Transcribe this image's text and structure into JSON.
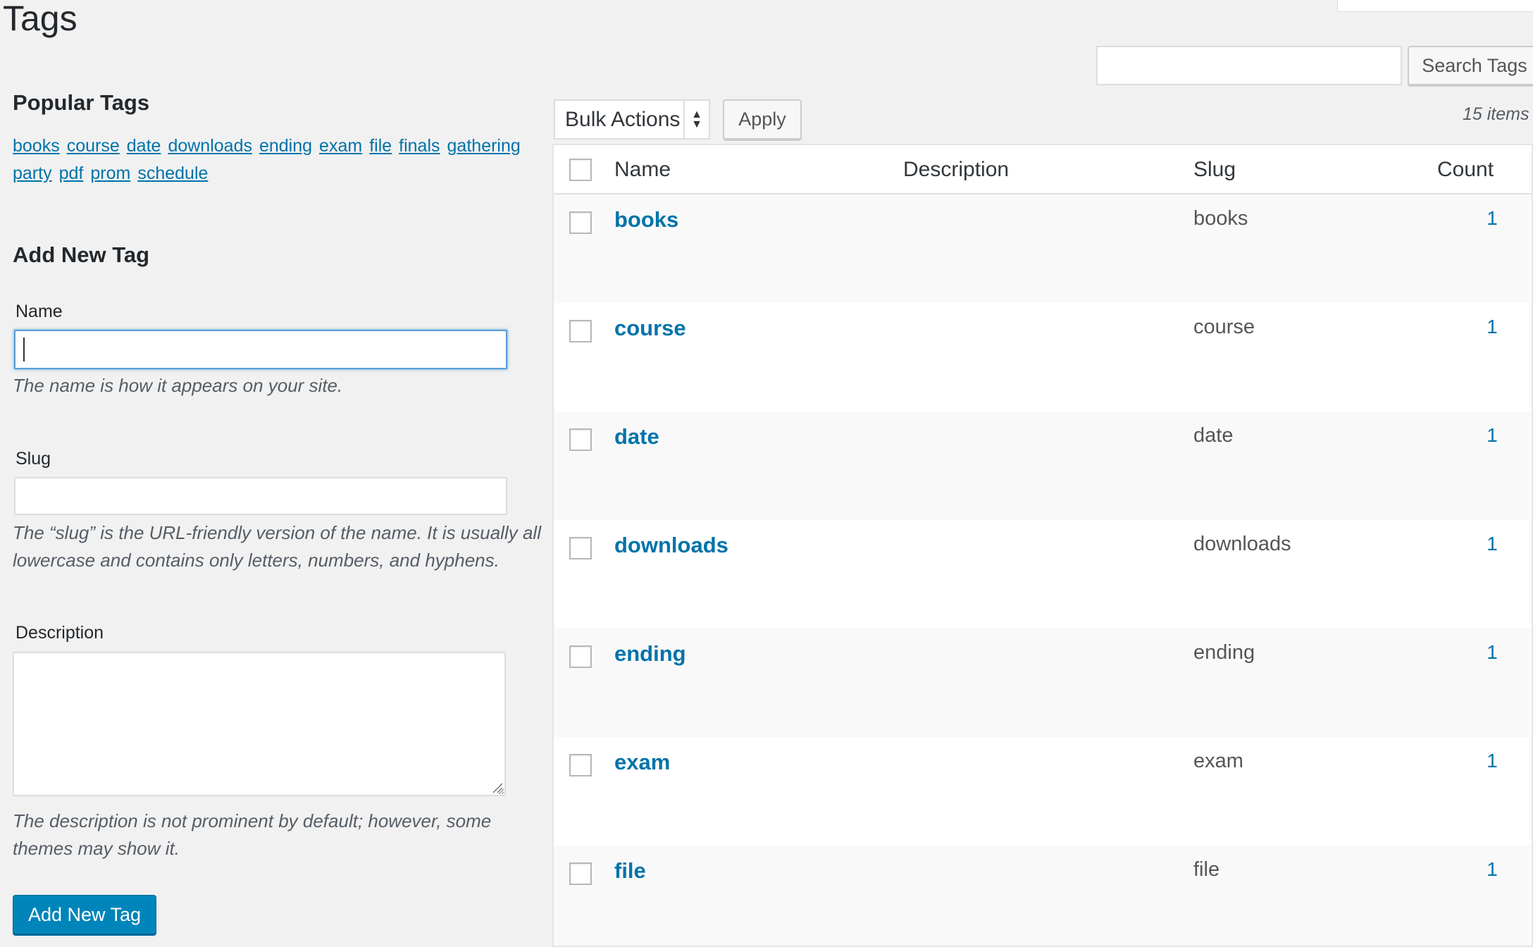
{
  "page": {
    "title": "Tags"
  },
  "popular_tags": {
    "title": "Popular Tags",
    "tags": [
      "books",
      "course",
      "date",
      "downloads",
      "ending",
      "exam",
      "file",
      "finals",
      "gathering",
      "party",
      "pdf",
      "prom",
      "schedule"
    ]
  },
  "add_form": {
    "title": "Add New Tag",
    "name_label": "Name",
    "name_help": "The name is how it appears on your site.",
    "slug_label": "Slug",
    "slug_help": "The “slug” is the URL-friendly version of the name. It is usually all lowercase and contains only letters, numbers, and hyphens.",
    "description_label": "Description",
    "description_help": "The description is not prominent by default; however, some themes may show it.",
    "submit_label": "Add New Tag"
  },
  "search": {
    "button_label": "Search Tags",
    "value": ""
  },
  "bulk": {
    "selected": "Bulk Actions",
    "apply_label": "Apply"
  },
  "items_count": "15 items",
  "table": {
    "headers": {
      "name": "Name",
      "description": "Description",
      "slug": "Slug",
      "count": "Count"
    },
    "rows": [
      {
        "name": "books",
        "slug": "books",
        "count": "1"
      },
      {
        "name": "course",
        "slug": "course",
        "count": "1"
      },
      {
        "name": "date",
        "slug": "date",
        "count": "1"
      },
      {
        "name": "downloads",
        "slug": "downloads",
        "count": "1"
      },
      {
        "name": "ending",
        "slug": "ending",
        "count": "1"
      },
      {
        "name": "exam",
        "slug": "exam",
        "count": "1"
      },
      {
        "name": "file",
        "slug": "file",
        "count": "1"
      }
    ]
  },
  "colors": {
    "link": "#0073aa",
    "primary_button": "#0085ba",
    "background": "#f1f1f1"
  }
}
